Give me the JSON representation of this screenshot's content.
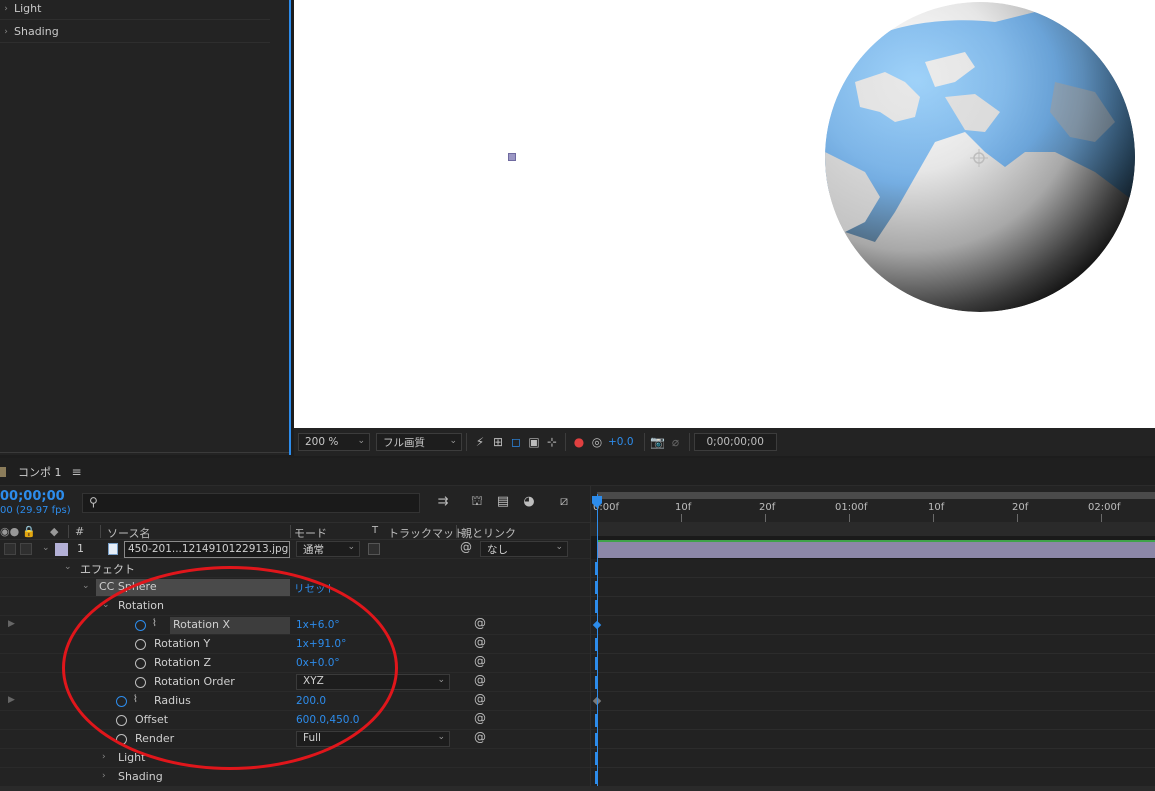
{
  "left_panel": {
    "items": [
      {
        "label": "Light"
      },
      {
        "label": "Shading"
      }
    ]
  },
  "viewer_toolbar": {
    "zoom": "200 %",
    "resolution": "フル画質",
    "exposure": "+0.0",
    "timecode": "0;00;00;00"
  },
  "timeline": {
    "tab_label": "コンポ 1",
    "menu_glyph": "≡",
    "timecode": "00;00;00",
    "fps": "00 (29.97 fps)",
    "columns": {
      "number": "#",
      "source_name": "ソース名",
      "mode": "モード",
      "track_matte_t": "T",
      "track_matte": "トラックマット",
      "parent": "親とリンク"
    },
    "layer": {
      "index": "1",
      "source": "450-201...1214910122913.jpg",
      "mode": "通常",
      "parent": "なし"
    },
    "effects_label": "エフェクト",
    "effect_name": "CC Sphere",
    "reset_label": "リセット",
    "rotation_group": "Rotation",
    "properties": [
      {
        "label": "Rotation X",
        "value": "1x+6.0°"
      },
      {
        "label": "Rotation Y",
        "value": "1x+91.0°"
      },
      {
        "label": "Rotation Z",
        "value": "0x+0.0°"
      },
      {
        "label": "Rotation Order",
        "value": "XYZ"
      },
      {
        "label": "Radius",
        "value": "200.0"
      },
      {
        "label": "Offset",
        "value": "600.0,450.0"
      },
      {
        "label": "Render",
        "value": "Full"
      },
      {
        "label": "Light"
      },
      {
        "label": "Shading"
      }
    ],
    "ruler": [
      "0:00f",
      "10f",
      "20f",
      "01:00f",
      "10f",
      "20f",
      "02:00f"
    ]
  },
  "colors": {
    "accent": "#2d8ceb",
    "annotation": "#e0161b",
    "layer_bar": "#8c87a8"
  }
}
